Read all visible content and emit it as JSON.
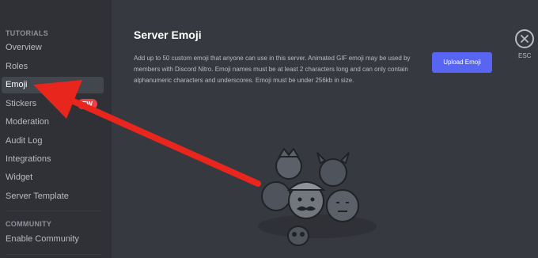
{
  "sidebar": {
    "tutorials_header": "TUTORIALS",
    "items": [
      {
        "label": "Overview"
      },
      {
        "label": "Roles"
      },
      {
        "label": "Emoji"
      },
      {
        "label": "Stickers",
        "badge": "EW"
      },
      {
        "label": "Moderation"
      },
      {
        "label": "Audit Log"
      },
      {
        "label": "Integrations"
      },
      {
        "label": "Widget"
      },
      {
        "label": "Server Template"
      }
    ],
    "community_header": "COMMUNITY",
    "community_items": [
      {
        "label": "Enable Community"
      }
    ]
  },
  "main": {
    "title": "Server Emoji",
    "description": "Add up to 50 custom emoji that anyone can use in this server. Animated GIF emoji may be used by members with Discord Nitro. Emoji names must be at least 2 characters long and can only contain alphanumeric characters and underscores. Emoji must be under 256kb in size.",
    "upload_button": "Upload Emoji",
    "close_label": "ESC",
    "close_icon": "close-icon"
  },
  "colors": {
    "sidebar_bg": "#2f3136",
    "main_bg": "#36393f",
    "accent": "#5865f2",
    "badge": "#ed4245",
    "arrow": "#e8261d"
  }
}
